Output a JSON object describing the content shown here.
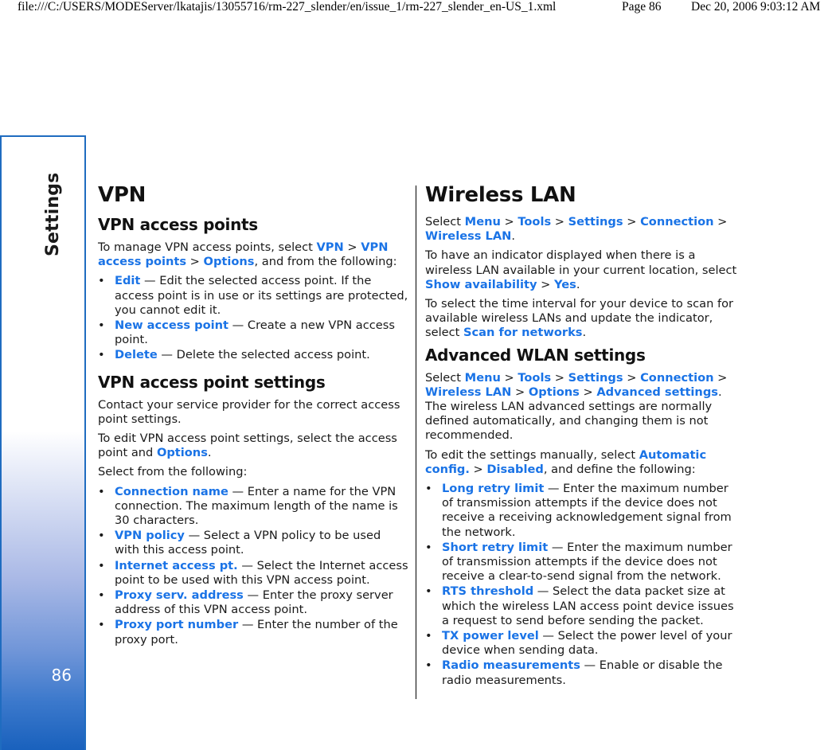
{
  "header": {
    "path": "file:///C:/USERS/MODEServer/lkatajis/13055716/rm-227_slender/en/issue_1/rm-227_slender_en-US_1.xml",
    "page": "Page 86",
    "date": "Dec 20, 2006 9:03:12 AM"
  },
  "sidebar": {
    "section": "Settings",
    "page_number": "86",
    "border_color": "#1f6cc0"
  },
  "colors": {
    "link": "#1a73e6",
    "text": "#1a1a1a"
  },
  "left": {
    "title": "VPN",
    "s1": {
      "heading": "VPN access points",
      "intro": [
        "To manage VPN access points, select ",
        "VPN",
        " > ",
        "VPN access points",
        " > ",
        "Options",
        ", and from the following:"
      ],
      "items": [
        {
          "term": "Edit",
          "desc": " — Edit the selected access point. If the access point is in use or its settings are protected, you cannot edit it."
        },
        {
          "term": "New access point",
          "desc": " — Create a new VPN access point."
        },
        {
          "term": "Delete",
          "desc": " — Delete the selected access point."
        }
      ]
    },
    "s2": {
      "heading": "VPN access point settings",
      "p1": "Contact your service provider for the correct access point settings.",
      "p2": [
        "To edit VPN access point settings, select the access point and ",
        "Options",
        "."
      ],
      "p3": "Select from the following:",
      "items": [
        {
          "term": "Connection name",
          "desc": " — Enter a name for the VPN connection. The maximum length of the name is 30 characters."
        },
        {
          "term": "VPN policy",
          "desc": " — Select a VPN policy to be used with this access point."
        },
        {
          "term": "Internet access pt.",
          "desc": " — Select the Internet access point to be used with this VPN access point."
        },
        {
          "term": "Proxy serv. address",
          "desc": " — Enter the proxy server address of this VPN access point."
        },
        {
          "term": "Proxy port number",
          "desc": " — Enter the number of the proxy port."
        }
      ]
    }
  },
  "right": {
    "title": "Wireless LAN",
    "p1": [
      "Select ",
      "Menu",
      " > ",
      "Tools",
      " > ",
      "Settings",
      " > ",
      "Connection",
      " > ",
      "Wireless LAN",
      "."
    ],
    "p2": [
      "To have an indicator displayed when there is a wireless LAN available in your current location, select ",
      "Show availability",
      " > ",
      "Yes",
      "."
    ],
    "p3": [
      "To select the time interval for your device to scan for available wireless LANs and update the indicator, select ",
      "Scan for networks",
      "."
    ],
    "s1": {
      "heading": "Advanced WLAN settings",
      "p1": [
        "Select ",
        "Menu",
        " > ",
        "Tools",
        " > ",
        "Settings",
        " > ",
        "Connection",
        " > ",
        "Wireless LAN",
        " > ",
        "Options",
        " > ",
        "Advanced settings",
        ". The wireless LAN advanced settings are normally defined automatically, and changing them is not recommended."
      ],
      "p2": [
        "To edit the settings manually, select ",
        "Automatic config.",
        " > ",
        "Disabled",
        ", and define the following:"
      ],
      "items": [
        {
          "term": "Long retry limit",
          "desc": " — Enter the maximum number of transmission attempts if the device does not receive a receiving acknowledgement signal from the network."
        },
        {
          "term": "Short retry limit",
          "desc": " — Enter the maximum number of transmission attempts if the device does not receive a clear-to-send signal from the network."
        },
        {
          "term": "RTS threshold",
          "desc": " — Select the data packet size at which the wireless LAN access point device issues a request to send before sending the packet."
        },
        {
          "term": "TX power level",
          "desc": " — Select the power level of your device when sending data."
        },
        {
          "term": "Radio measurements",
          "desc": " — Enable or disable the radio measurements."
        }
      ]
    }
  },
  "bullet_glyph": "•"
}
